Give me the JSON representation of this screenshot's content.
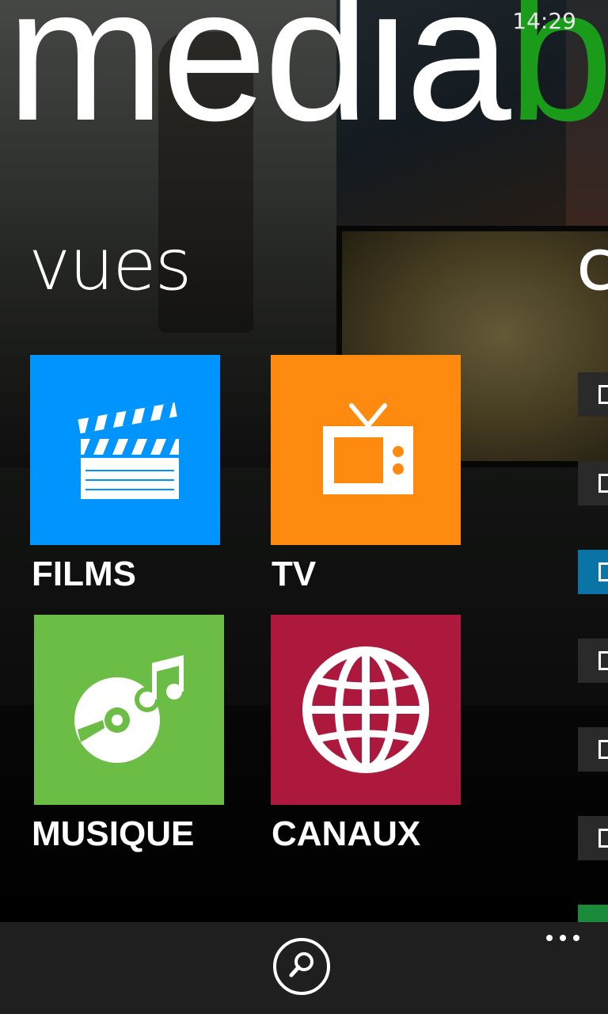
{
  "status_bar": {
    "time": "14:29"
  },
  "app": {
    "title_main": "media",
    "title_accent": "b",
    "accent_color": "#1a9c1a"
  },
  "sections": {
    "current": "vues",
    "next_peek": "c"
  },
  "tiles": [
    {
      "label": "FILMS",
      "color": "#0094ff",
      "icon": "clapperboard-icon"
    },
    {
      "label": "TV",
      "color": "#ff8a10",
      "icon": "tv-icon"
    },
    {
      "label": "MUSIQUE",
      "color": "#6cbd45",
      "icon": "music-disc-icon"
    },
    {
      "label": "CANAUX",
      "color": "#ac193d",
      "icon": "globe-icon"
    }
  ],
  "side_peek_items": [
    {
      "color": "#2a2a2a"
    },
    {
      "color": "#2a2a2a"
    },
    {
      "color": "#0b74a6"
    },
    {
      "color": "#2a2a2a"
    },
    {
      "color": "#2a2a2a"
    },
    {
      "color": "#2a2a2a"
    },
    {
      "color": "#1b8a3a"
    }
  ],
  "app_bar": {
    "search_icon": "search-icon",
    "more_icon": "more-dots-icon"
  }
}
